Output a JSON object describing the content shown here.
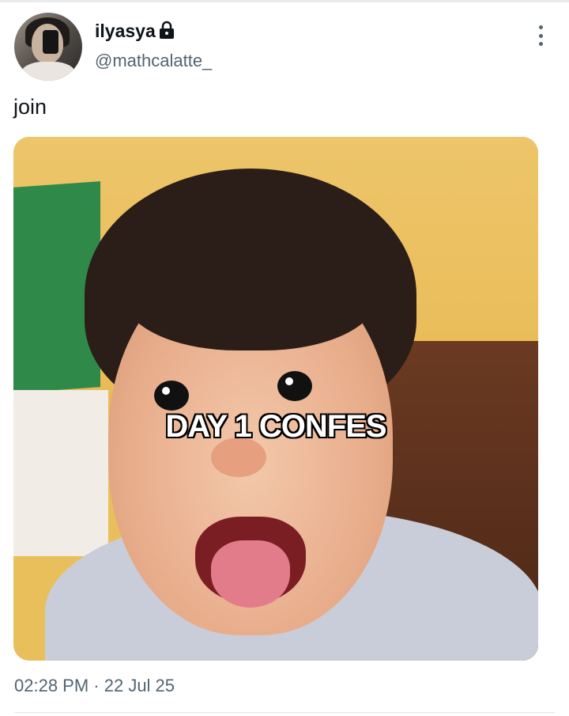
{
  "author": {
    "display_name": "ilyasya",
    "handle": "@mathcalatte_",
    "protected_icon": "lock-icon",
    "avatar_icon": "avatar"
  },
  "tweet": {
    "text": "join",
    "media_caption": "DAY 1 CONFES",
    "time": "02:28 PM",
    "separator": " · ",
    "date": "22 Jul 25"
  },
  "actions": {
    "more_icon": "more-options-icon"
  },
  "colors": {
    "secondary_text": "#536471",
    "primary_text": "#0f1419"
  }
}
